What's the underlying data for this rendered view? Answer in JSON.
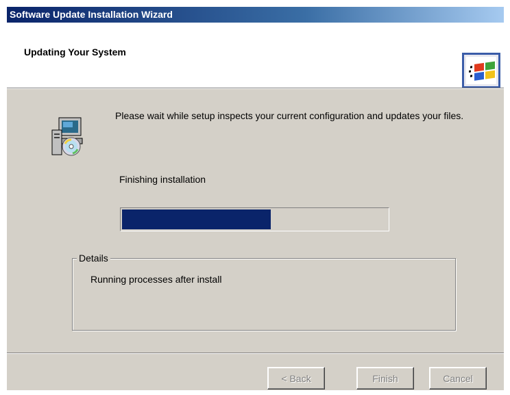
{
  "window": {
    "title": "Software Update Installation Wizard"
  },
  "header": {
    "title": "Updating Your System",
    "logo_icon": "windows-flag-icon"
  },
  "body": {
    "setup_icon": "setup-computer-cd-icon",
    "message": "Please wait while setup inspects your current configuration and updates your files.",
    "status": "Finishing installation",
    "progress": {
      "fraction": 0.56,
      "fill_color": "#0a246a"
    }
  },
  "details": {
    "legend": "Details",
    "text": "Running processes after install"
  },
  "buttons": {
    "back": "< Back",
    "finish": "Finish",
    "cancel": "Cancel"
  },
  "colors": {
    "face": "#d4d0c8",
    "titlebar_start": "#0a246a",
    "titlebar_end": "#a6caf0"
  }
}
